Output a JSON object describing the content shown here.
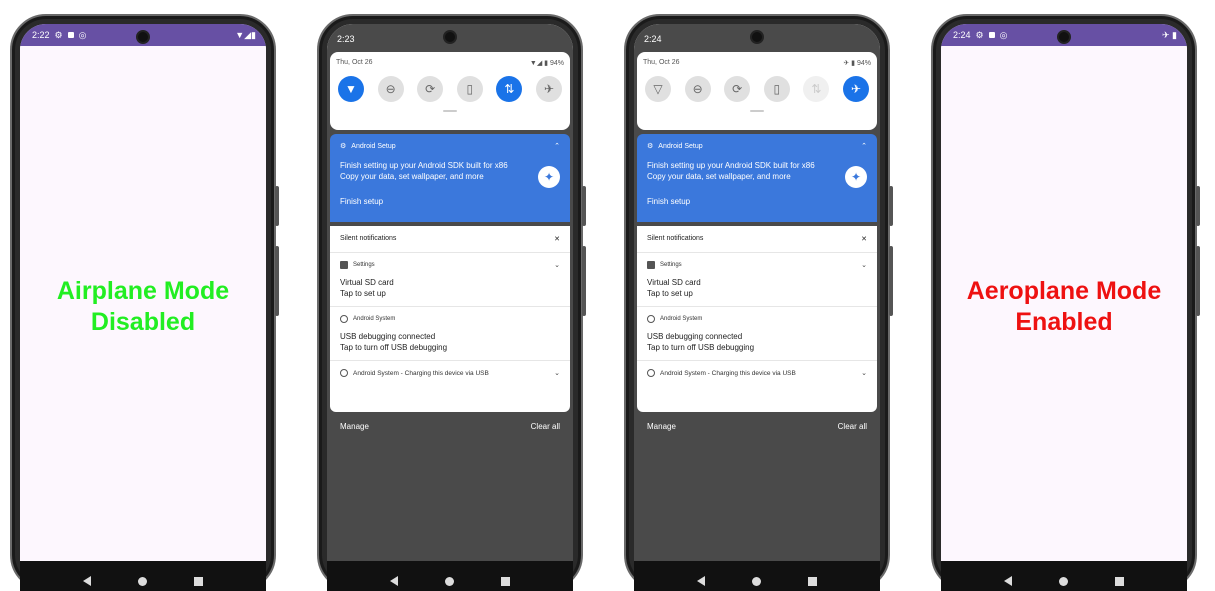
{
  "phones": [
    {
      "status_bar": {
        "time": "2:22",
        "right_icons": "▼◢▮"
      },
      "status_color": "#6750a4",
      "message_line1": "Airplane Mode",
      "message_line2": "Disabled",
      "message_color": "#22ee22"
    },
    {
      "status_bar": {
        "time": "2:23"
      },
      "quick_settings": {
        "date": "Thu, Oct 26",
        "status_right": "▼◢ ▮ 94%"
      },
      "setup_card": {
        "app_name": "Android Setup",
        "line1": "Finish setting up your Android SDK built for x86",
        "line2": "Copy your data, set wallpaper, and more",
        "action": "Finish setup"
      },
      "silent": {
        "header": "Silent notifications",
        "notifications": [
          {
            "app": "Settings",
            "title": "Virtual SD card",
            "sub": "Tap to set up"
          },
          {
            "app": "Android System",
            "title": "USB debugging connected",
            "sub": "Tap to turn off USB debugging"
          },
          {
            "app": "Android System - Charging this device via USB"
          }
        ]
      },
      "manage": "Manage",
      "clear_all": "Clear all"
    },
    {
      "status_bar": {
        "time": "2:24"
      },
      "quick_settings": {
        "date": "Thu, Oct 26",
        "status_right": "✈ ▮ 94%"
      },
      "setup_card": {
        "app_name": "Android Setup",
        "line1": "Finish setting up your Android SDK built for x86",
        "line2": "Copy your data, set wallpaper, and more",
        "action": "Finish setup"
      },
      "silent": {
        "header": "Silent notifications",
        "notifications": [
          {
            "app": "Settings",
            "title": "Virtual SD card",
            "sub": "Tap to set up"
          },
          {
            "app": "Android System",
            "title": "USB debugging connected",
            "sub": "Tap to turn off USB debugging"
          },
          {
            "app": "Android System - Charging this device via USB"
          }
        ]
      },
      "manage": "Manage",
      "clear_all": "Clear all"
    },
    {
      "status_bar": {
        "time": "2:24",
        "right_icons": "✈ ▮"
      },
      "status_color": "#6750a4",
      "message_line1": "Aeroplane Mode",
      "message_line2": "Enabled",
      "message_color": "#ee1111"
    }
  ],
  "colors": {
    "accent_blue": "#1a73e8",
    "setup_card_blue": "#3b78dc"
  }
}
